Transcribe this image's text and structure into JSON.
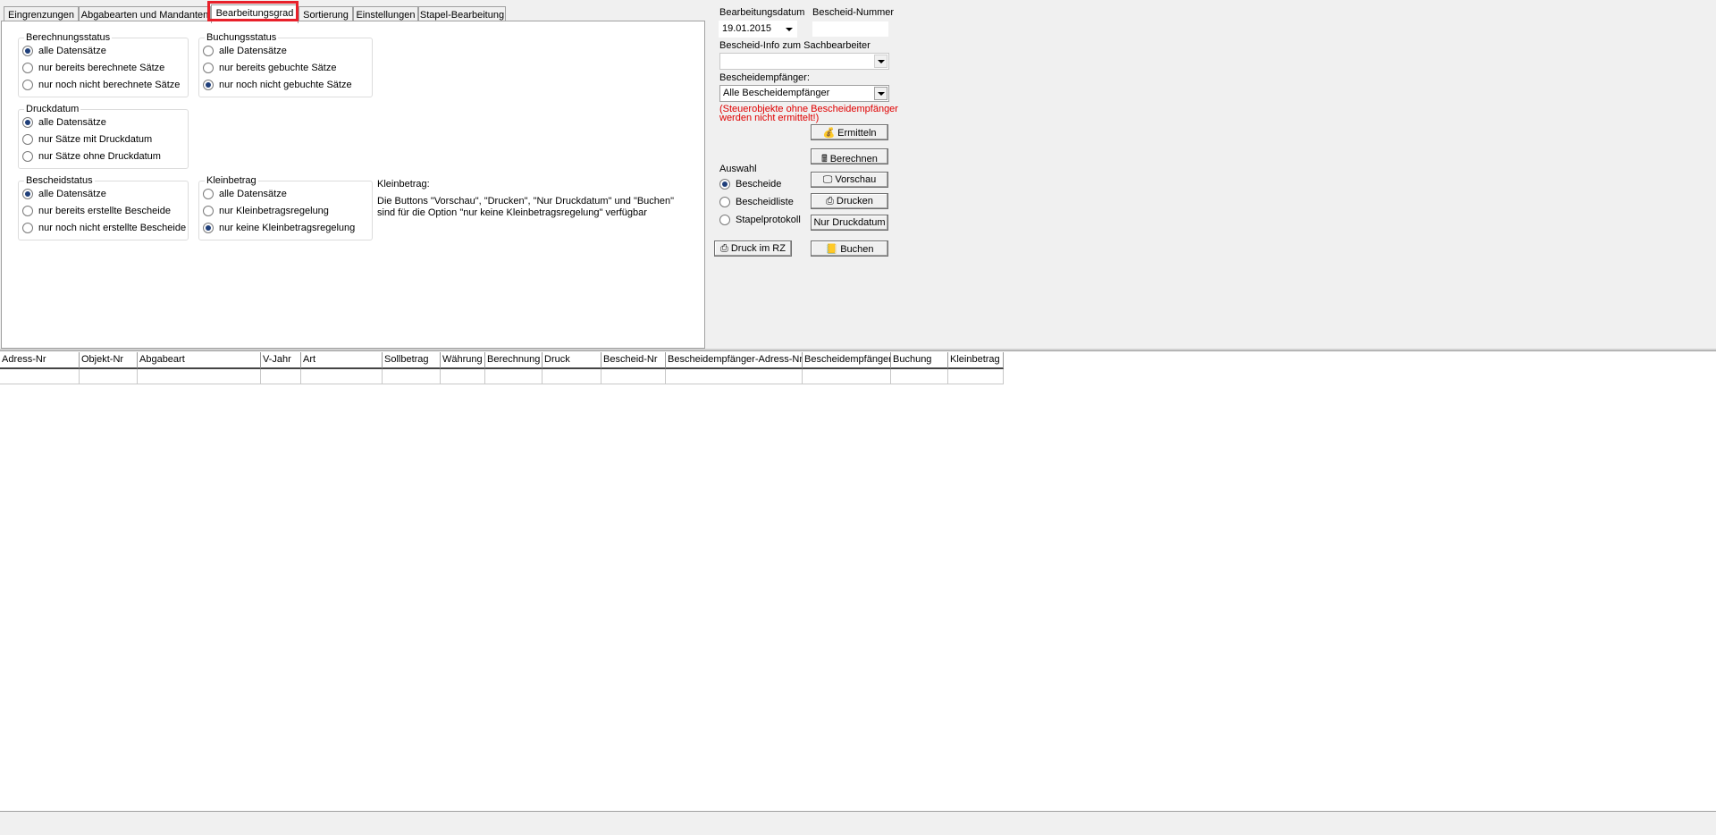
{
  "tabs": [
    "Eingrenzungen",
    "Abgabearten und Mandanten",
    "Bearbeitungsgrad",
    "Sortierung",
    "Einstellungen",
    "Stapel-Bearbeitung"
  ],
  "active_tab": "Bearbeitungsgrad",
  "groups": {
    "berechnungsstatus": {
      "title": "Berechnungsstatus",
      "options": [
        "alle Datensätze",
        "nur bereits berechnete Sätze",
        "nur noch nicht berechnete Sätze"
      ],
      "selected": 0
    },
    "buchungsstatus": {
      "title": "Buchungsstatus",
      "options": [
        "alle Datensätze",
        "nur bereits gebuchte Sätze",
        "nur noch nicht gebuchte Sätze"
      ],
      "selected": 2
    },
    "druckdatum": {
      "title": "Druckdatum",
      "options": [
        "alle Datensätze",
        "nur Sätze mit Druckdatum",
        "nur Sätze ohne Druckdatum"
      ],
      "selected": 0
    },
    "bescheidstatus": {
      "title": "Bescheidstatus",
      "options": [
        "alle Datensätze",
        "nur bereits erstellte Bescheide",
        "nur noch nicht erstellte Bescheide"
      ],
      "selected": 0
    },
    "kleinbetrag": {
      "title": "Kleinbetrag",
      "options": [
        "alle Datensätze",
        "nur Kleinbetragsregelung",
        "nur keine Kleinbetragsregelung"
      ],
      "selected": 2
    }
  },
  "kleinbetrag_note": {
    "title": "Kleinbetrag:",
    "line1": "Die Buttons \"Vorschau\", \"Drucken\", \"Nur Druckdatum\" und \"Buchen\"",
    "line2": "sind für die Option \"nur keine Kleinbetragsregelung\" verfügbar"
  },
  "right": {
    "bearbeitungsdatum_label": "Bearbeitungsdatum",
    "bearbeitungsdatum_value": "19.01.2015",
    "bescheid_nummer_label": "Bescheid-Nummer",
    "bescheid_nummer_value": "",
    "bescheid_info_label": "Bescheid-Info zum Sachbearbeiter",
    "bescheid_info_value": "",
    "empfaenger_label": "Bescheidempfänger:",
    "empfaenger_value": "Alle Bescheidempfänger",
    "warning_line1": "(Steuerobjekte ohne Bescheidempfänger",
    "warning_line2": " werden nicht ermittelt!)",
    "auswahl_title": "Auswahl",
    "auswahl_options": [
      "Bescheide",
      "Bescheidliste",
      "Stapelprotokoll"
    ],
    "auswahl_selected": 0,
    "buttons": {
      "ermitteln": "Ermitteln",
      "berechnen": "Berechnen",
      "vorschau": "Vorschau",
      "drucken": "Drucken",
      "nur_druckdatum": "Nur Druckdatum",
      "druck_im_rz": "Druck im RZ",
      "buchen": "Buchen"
    }
  },
  "grid": {
    "columns": [
      "Adress-Nr",
      "Objekt-Nr",
      "Abgabeart",
      "V-Jahr",
      "Art",
      "Sollbetrag",
      "Währung",
      "Berechnung",
      "Druck",
      "Bescheid-Nr",
      "Bescheidempfänger-Adress-Nr.",
      "Bescheidempfänger",
      "Buchung",
      "Kleinbetrag"
    ]
  }
}
